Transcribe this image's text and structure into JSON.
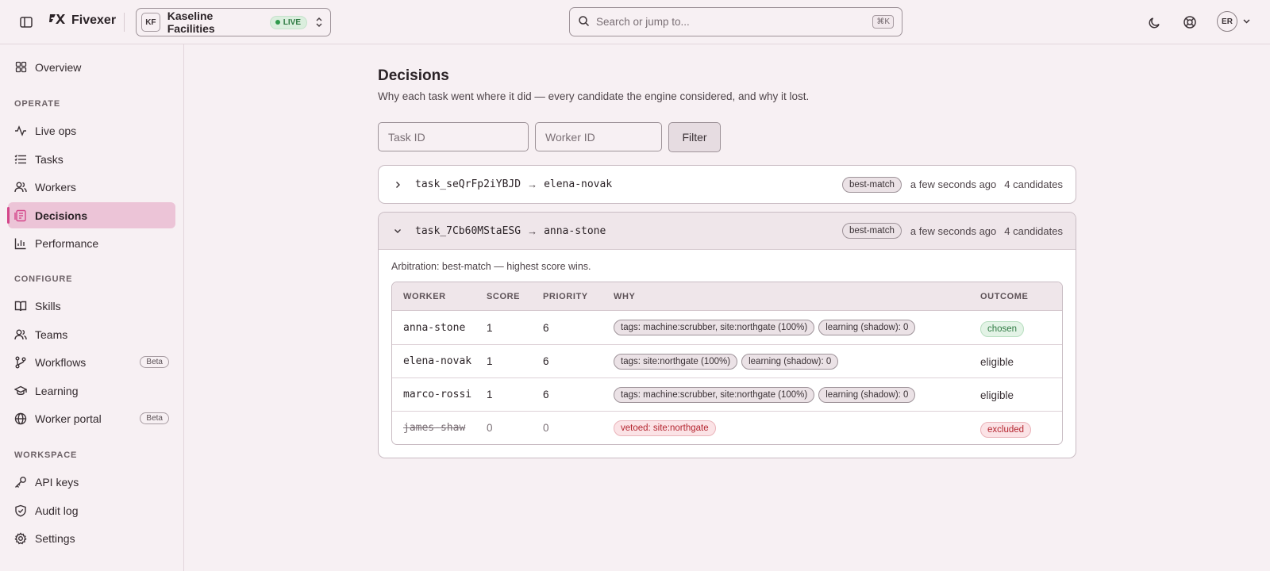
{
  "app": {
    "name": "Fivexer",
    "org": {
      "initials": "KF",
      "name": "Kaseline Facilities",
      "env_badge": "LIVE"
    },
    "search": {
      "placeholder": "Search or jump to...",
      "shortcut": "⌘K"
    },
    "user": {
      "initials": "ER"
    }
  },
  "sidebar": {
    "top": [
      {
        "label": "Overview",
        "icon": "grid-icon"
      }
    ],
    "sections": [
      {
        "label": "OPERATE",
        "items": [
          {
            "label": "Live ops",
            "icon": "activity-icon"
          },
          {
            "label": "Tasks",
            "icon": "list-icon"
          },
          {
            "label": "Workers",
            "icon": "users-icon"
          },
          {
            "label": "Decisions",
            "icon": "decisions-icon",
            "active": true
          },
          {
            "label": "Performance",
            "icon": "bar-chart-icon"
          }
        ]
      },
      {
        "label": "CONFIGURE",
        "items": [
          {
            "label": "Skills",
            "icon": "book-icon"
          },
          {
            "label": "Teams",
            "icon": "team-icon"
          },
          {
            "label": "Workflows",
            "icon": "branch-icon",
            "badge": "Beta"
          },
          {
            "label": "Learning",
            "icon": "graduation-cap-icon"
          },
          {
            "label": "Worker portal",
            "icon": "globe-icon",
            "badge": "Beta"
          }
        ]
      },
      {
        "label": "WORKSPACE",
        "items": [
          {
            "label": "API keys",
            "icon": "key-icon"
          },
          {
            "label": "Audit log",
            "icon": "shield-check-icon"
          },
          {
            "label": "Settings",
            "icon": "gear-icon"
          }
        ]
      }
    ]
  },
  "page": {
    "title": "Decisions",
    "subtitle": "Why each task went where it did — every candidate the engine considered, and why it lost.",
    "filters": {
      "task_placeholder": "Task ID",
      "worker_placeholder": "Worker ID",
      "button": "Filter"
    },
    "decisions": [
      {
        "task": "task_seQrFp2iYBJD",
        "arrow": "→",
        "assignee": "elena-novak",
        "strategy": "best-match",
        "time": "a few seconds ago",
        "count": "4 candidates",
        "expanded": false
      },
      {
        "task": "task_7Cb60MStaESG",
        "arrow": "→",
        "assignee": "anna-stone",
        "strategy": "best-match",
        "time": "a few seconds ago",
        "count": "4 candidates",
        "expanded": true,
        "arbitration": "Arbitration: best-match — highest score wins.",
        "columns": [
          "WORKER",
          "SCORE",
          "PRIORITY",
          "WHY",
          "OUTCOME"
        ],
        "candidates": [
          {
            "worker": "anna-stone",
            "score": "1",
            "priority": "6",
            "why": [
              "tags: machine:scrubber, site:northgate (100%)",
              "learning (shadow): 0"
            ],
            "outcome": "chosen",
            "status": "chosen"
          },
          {
            "worker": "elena-novak",
            "score": "1",
            "priority": "6",
            "why": [
              "tags: site:northgate (100%)",
              "learning (shadow): 0"
            ],
            "outcome": "eligible",
            "status": "eligible"
          },
          {
            "worker": "marco-rossi",
            "score": "1",
            "priority": "6",
            "why": [
              "tags: machine:scrubber, site:northgate (100%)",
              "learning (shadow): 0"
            ],
            "outcome": "eligible",
            "status": "eligible"
          },
          {
            "worker": "james-shaw",
            "score": "0",
            "priority": "0",
            "why": [
              "vetoed: site:northgate"
            ],
            "outcome": "excluded",
            "status": "excluded"
          }
        ]
      }
    ]
  },
  "colors": {
    "accent": "#d4468a",
    "active_bg": "#ecc4d7",
    "success": "#2f7a43",
    "danger": "#b4252f",
    "background": "#f7f0f3"
  }
}
